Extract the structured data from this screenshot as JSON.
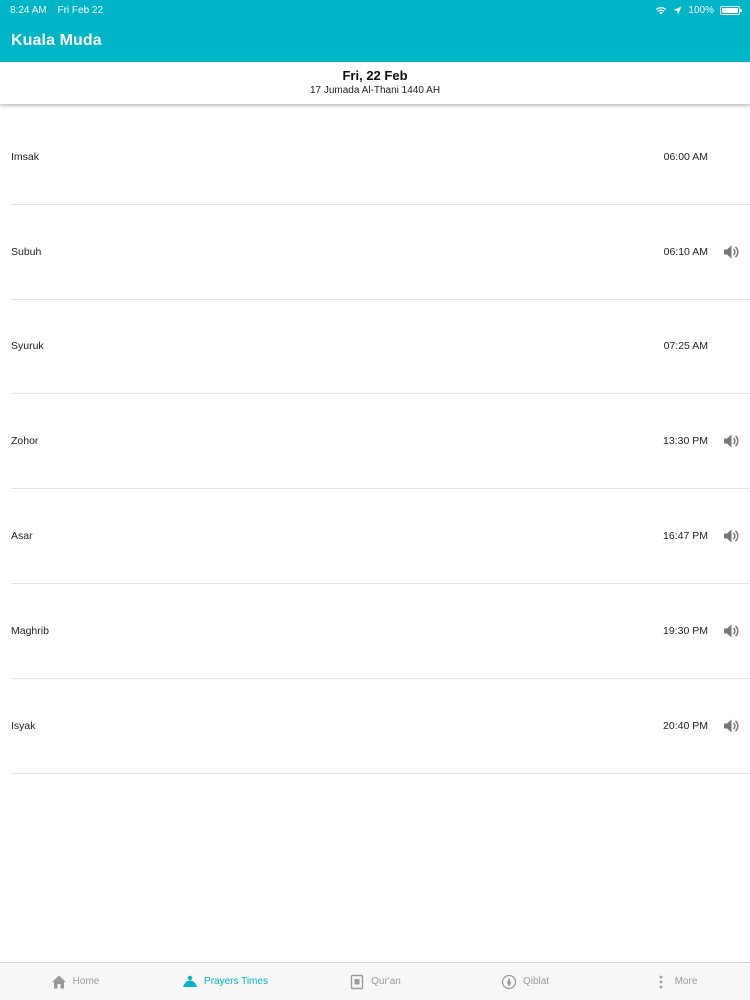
{
  "status_bar": {
    "time": "8:24 AM",
    "date": "Fri Feb 22",
    "battery": "100%"
  },
  "header": {
    "title": "Kuala Muda"
  },
  "date": {
    "gregorian": "Fri, 22 Feb",
    "hijri": "17 Jumada Al-Thani 1440 AH"
  },
  "prayers": [
    {
      "name": "Imsak",
      "time": "06:00 AM",
      "sound": false
    },
    {
      "name": "Subuh",
      "time": "06:10 AM",
      "sound": true
    },
    {
      "name": "Syuruk",
      "time": "07:25 AM",
      "sound": false
    },
    {
      "name": "Zohor",
      "time": "13:30 PM",
      "sound": true
    },
    {
      "name": "Asar",
      "time": "16:47 PM",
      "sound": true
    },
    {
      "name": "Maghrib",
      "time": "19:30 PM",
      "sound": true
    },
    {
      "name": "Isyak",
      "time": "20:40 PM",
      "sound": true
    }
  ],
  "tabs": [
    {
      "label": "Home",
      "icon": "home-icon",
      "active": false
    },
    {
      "label": "Prayers Times",
      "icon": "prayer-icon",
      "active": true
    },
    {
      "label": "Qur'an",
      "icon": "quran-icon",
      "active": false
    },
    {
      "label": "Qiblat",
      "icon": "compass-icon",
      "active": false
    },
    {
      "label": "More",
      "icon": "more-icon",
      "active": false
    }
  ],
  "colors": {
    "primary": "#00b5c8",
    "tab_inactive": "#9a9a9a",
    "divider": "#e3e3e3"
  }
}
